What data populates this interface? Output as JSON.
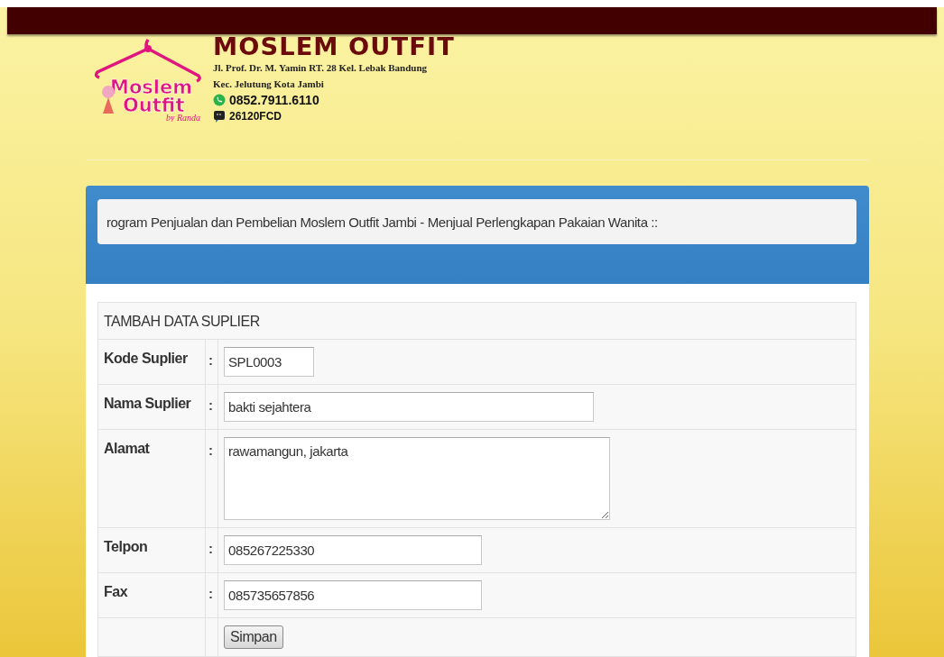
{
  "header": {
    "title": "MOSLEM OUTFIT",
    "logo_words": [
      "Moslem",
      "Outfit",
      "by Randa"
    ],
    "address": [
      "Jl. Prof. Dr. M. Yamin RT. 28 Kel. Lebak Bandung",
      "Kec. Jelutung Kota Jambi"
    ],
    "phone": "0852.7911.6110",
    "pin": "26120FCD"
  },
  "panel": {
    "marquee": "rogram Penjualan dan Pembelian Moslem Outfit Jambi - Menjual Perlengkapan Pakaian Wanita ::"
  },
  "form": {
    "title": "TAMBAH DATA SUPLIER",
    "fields": [
      {
        "label": "Kode Suplier",
        "separator": ":",
        "value": "SPL0003",
        "kind": "input"
      },
      {
        "label": "Nama Suplier",
        "separator": ":",
        "value": "bakti sejahtera",
        "kind": "input"
      },
      {
        "label": "Alamat",
        "separator": ":",
        "value": "rawamangun, jakarta",
        "kind": "textarea"
      },
      {
        "label": "Telpon",
        "separator": ":",
        "value": "085267225330",
        "kind": "input"
      },
      {
        "label": "Fax",
        "separator": ":",
        "value": "085735657856",
        "kind": "input"
      }
    ],
    "submit": "Simpan"
  }
}
